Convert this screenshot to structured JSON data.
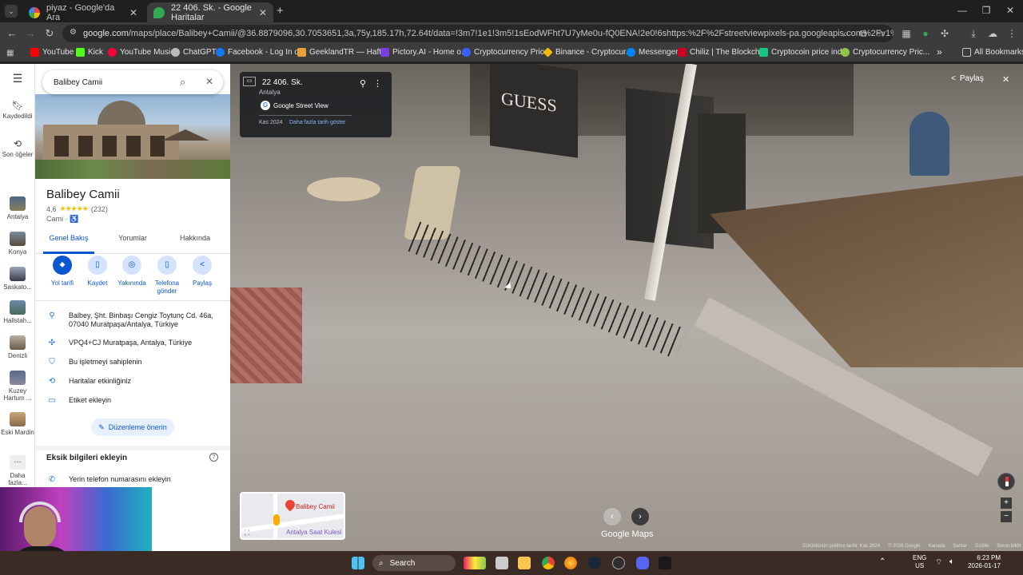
{
  "tabs": [
    {
      "title": "piyaz - Google'da Ara",
      "close": "✕"
    },
    {
      "title": "22 406. Sk. - Google Haritalar",
      "close": "✕"
    }
  ],
  "new_tab": "+",
  "window_controls": {
    "minimize": "—",
    "restore": "❐",
    "close": "✕"
  },
  "toolbar": {
    "url_host": "google.com",
    "url_path": "/maps/place/Balibey+Camii/@36.8879096,30.7053651,3a,75y,185.17h,72.64t/data=!3m7!1e1!3m5!1sEodWFht7U7yMe0u-fQ0ENA!2e0!6shttps:%2F%2Fstreetviewpixels-pa.googleapis.com%2Fv1%2Fthumbnail%3Fcb_..."
  },
  "bookmarks": [
    {
      "label": "YouTube",
      "color": "#ff0000"
    },
    {
      "label": "Kick",
      "color": "#53fc18"
    },
    {
      "label": "YouTube Music",
      "color": "#ff0033"
    },
    {
      "label": "ChatGPT",
      "color": "#bbbbbb"
    },
    {
      "label": "Facebook - Log In o...",
      "color": "#1877f2"
    },
    {
      "label": "GeeklandTR — Haft...",
      "color": "#e9a23b"
    },
    {
      "label": "Pictory.AI - Home o...",
      "color": "#7b3fe4"
    },
    {
      "label": "Cryptocurrency Pric...",
      "color": "#3861fb"
    },
    {
      "label": "Binance - Cryptocur...",
      "color": "#f0b90b"
    },
    {
      "label": "Messenger",
      "color": "#0084ff"
    },
    {
      "label": "Chiliz | The Blockch...",
      "color": "#cd0124"
    },
    {
      "label": "Cryptocoin price ind...",
      "color": "#16c784"
    },
    {
      "label": "Cryptocurrency Pric...",
      "color": "#8dc647"
    }
  ],
  "bookmarks_overflow": "»",
  "all_bookmarks": "All Bookmarks",
  "rail": {
    "saved": "Kaydedildi",
    "recent": "Son öğeler",
    "items": [
      "Antalya",
      "Konya",
      "Saskato...",
      "Hallstah...",
      "Denizli",
      "Kuzey Hartum ...",
      "Eski Mardin"
    ],
    "more": "Daha fazla..."
  },
  "panel": {
    "search_value": "Balibey Camii",
    "place_name": "Balibey Camii",
    "rating": "4,6",
    "stars": "★★★★★",
    "reviews": "(232)",
    "category": "Cami · ♿",
    "tabs": [
      "Genel Bakış",
      "Yorumlar",
      "Hakkında"
    ],
    "actions": [
      "Yol tarifi",
      "Kaydet",
      "Yakınında",
      "Telefona gönder",
      "Paylaş"
    ],
    "address_line1": "Balbey, Şht. Binbaşı Cengiz Toytunç Cd. 46a,",
    "address_line2": "07040 Muratpaşa/Antalya, Türkiye",
    "plus_code": "VPQ4+CJ Muratpaşa, Antalya, Türkiye",
    "claim": "Bu işletmeyi sahiplenin",
    "maps_activity": "Haritalar etkinliğiniz",
    "add_label": "Etiket ekleyin",
    "suggest_edit": "Düzenleme önerin",
    "missing_info": "Eksik bilgileri ekleyin",
    "add_phone": "Yerin telefon numarasını ekleyin"
  },
  "streetview": {
    "street": "22 406. Sk.",
    "city": "Antalya",
    "source": "Google Street View",
    "date": "Kas 2024",
    "more_dates": "Daha fazla tarih göster",
    "share": "Paylaş",
    "close": "✕",
    "minimap_label": "Balibey Camii",
    "minimap_label2": "Antalya Saat Kulesi",
    "logo": "Google Maps",
    "footer": [
      "Görüntünün çekilme tarihi: Kas 2024",
      "© 2026 Google",
      "Kanada",
      "Şartlar",
      "Gizlilik",
      "Sorun bildir"
    ],
    "shop_sign": "GUESS"
  },
  "taskbar": {
    "search": "Search",
    "lang": "ENG",
    "lang2": "US",
    "time": "6:23 PM",
    "date": "2026-01-17"
  }
}
